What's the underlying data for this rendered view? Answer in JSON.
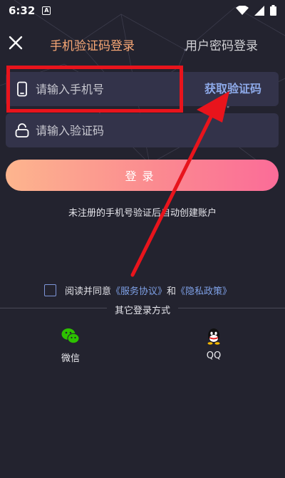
{
  "status_bar": {
    "time": "6:32",
    "notice_icon_letter": "A"
  },
  "header": {
    "tab_sms_login": "手机验证码登录",
    "tab_password_login": "用户密码登录"
  },
  "form": {
    "phone_placeholder": "请输入手机号",
    "get_code_label": "获取验证码",
    "code_placeholder": "请输入验证码",
    "login_label": "登录",
    "auto_register_hint": "未注册的手机号验证后自动创建账户"
  },
  "agreement": {
    "prefix": "阅读并同意",
    "service_link": "《服务协议》",
    "conjunction": "和",
    "privacy_link": "《隐私政策》"
  },
  "other_login": {
    "title": "其它登录方式",
    "options": [
      {
        "label": "微信",
        "icon": "wechat-icon"
      },
      {
        "label": "QQ",
        "icon": "qq-icon"
      }
    ]
  },
  "colors": {
    "background": "#23232f",
    "active_tab": "#f8a775",
    "link": "#7ea0e6",
    "annotation": "#e8141c"
  }
}
